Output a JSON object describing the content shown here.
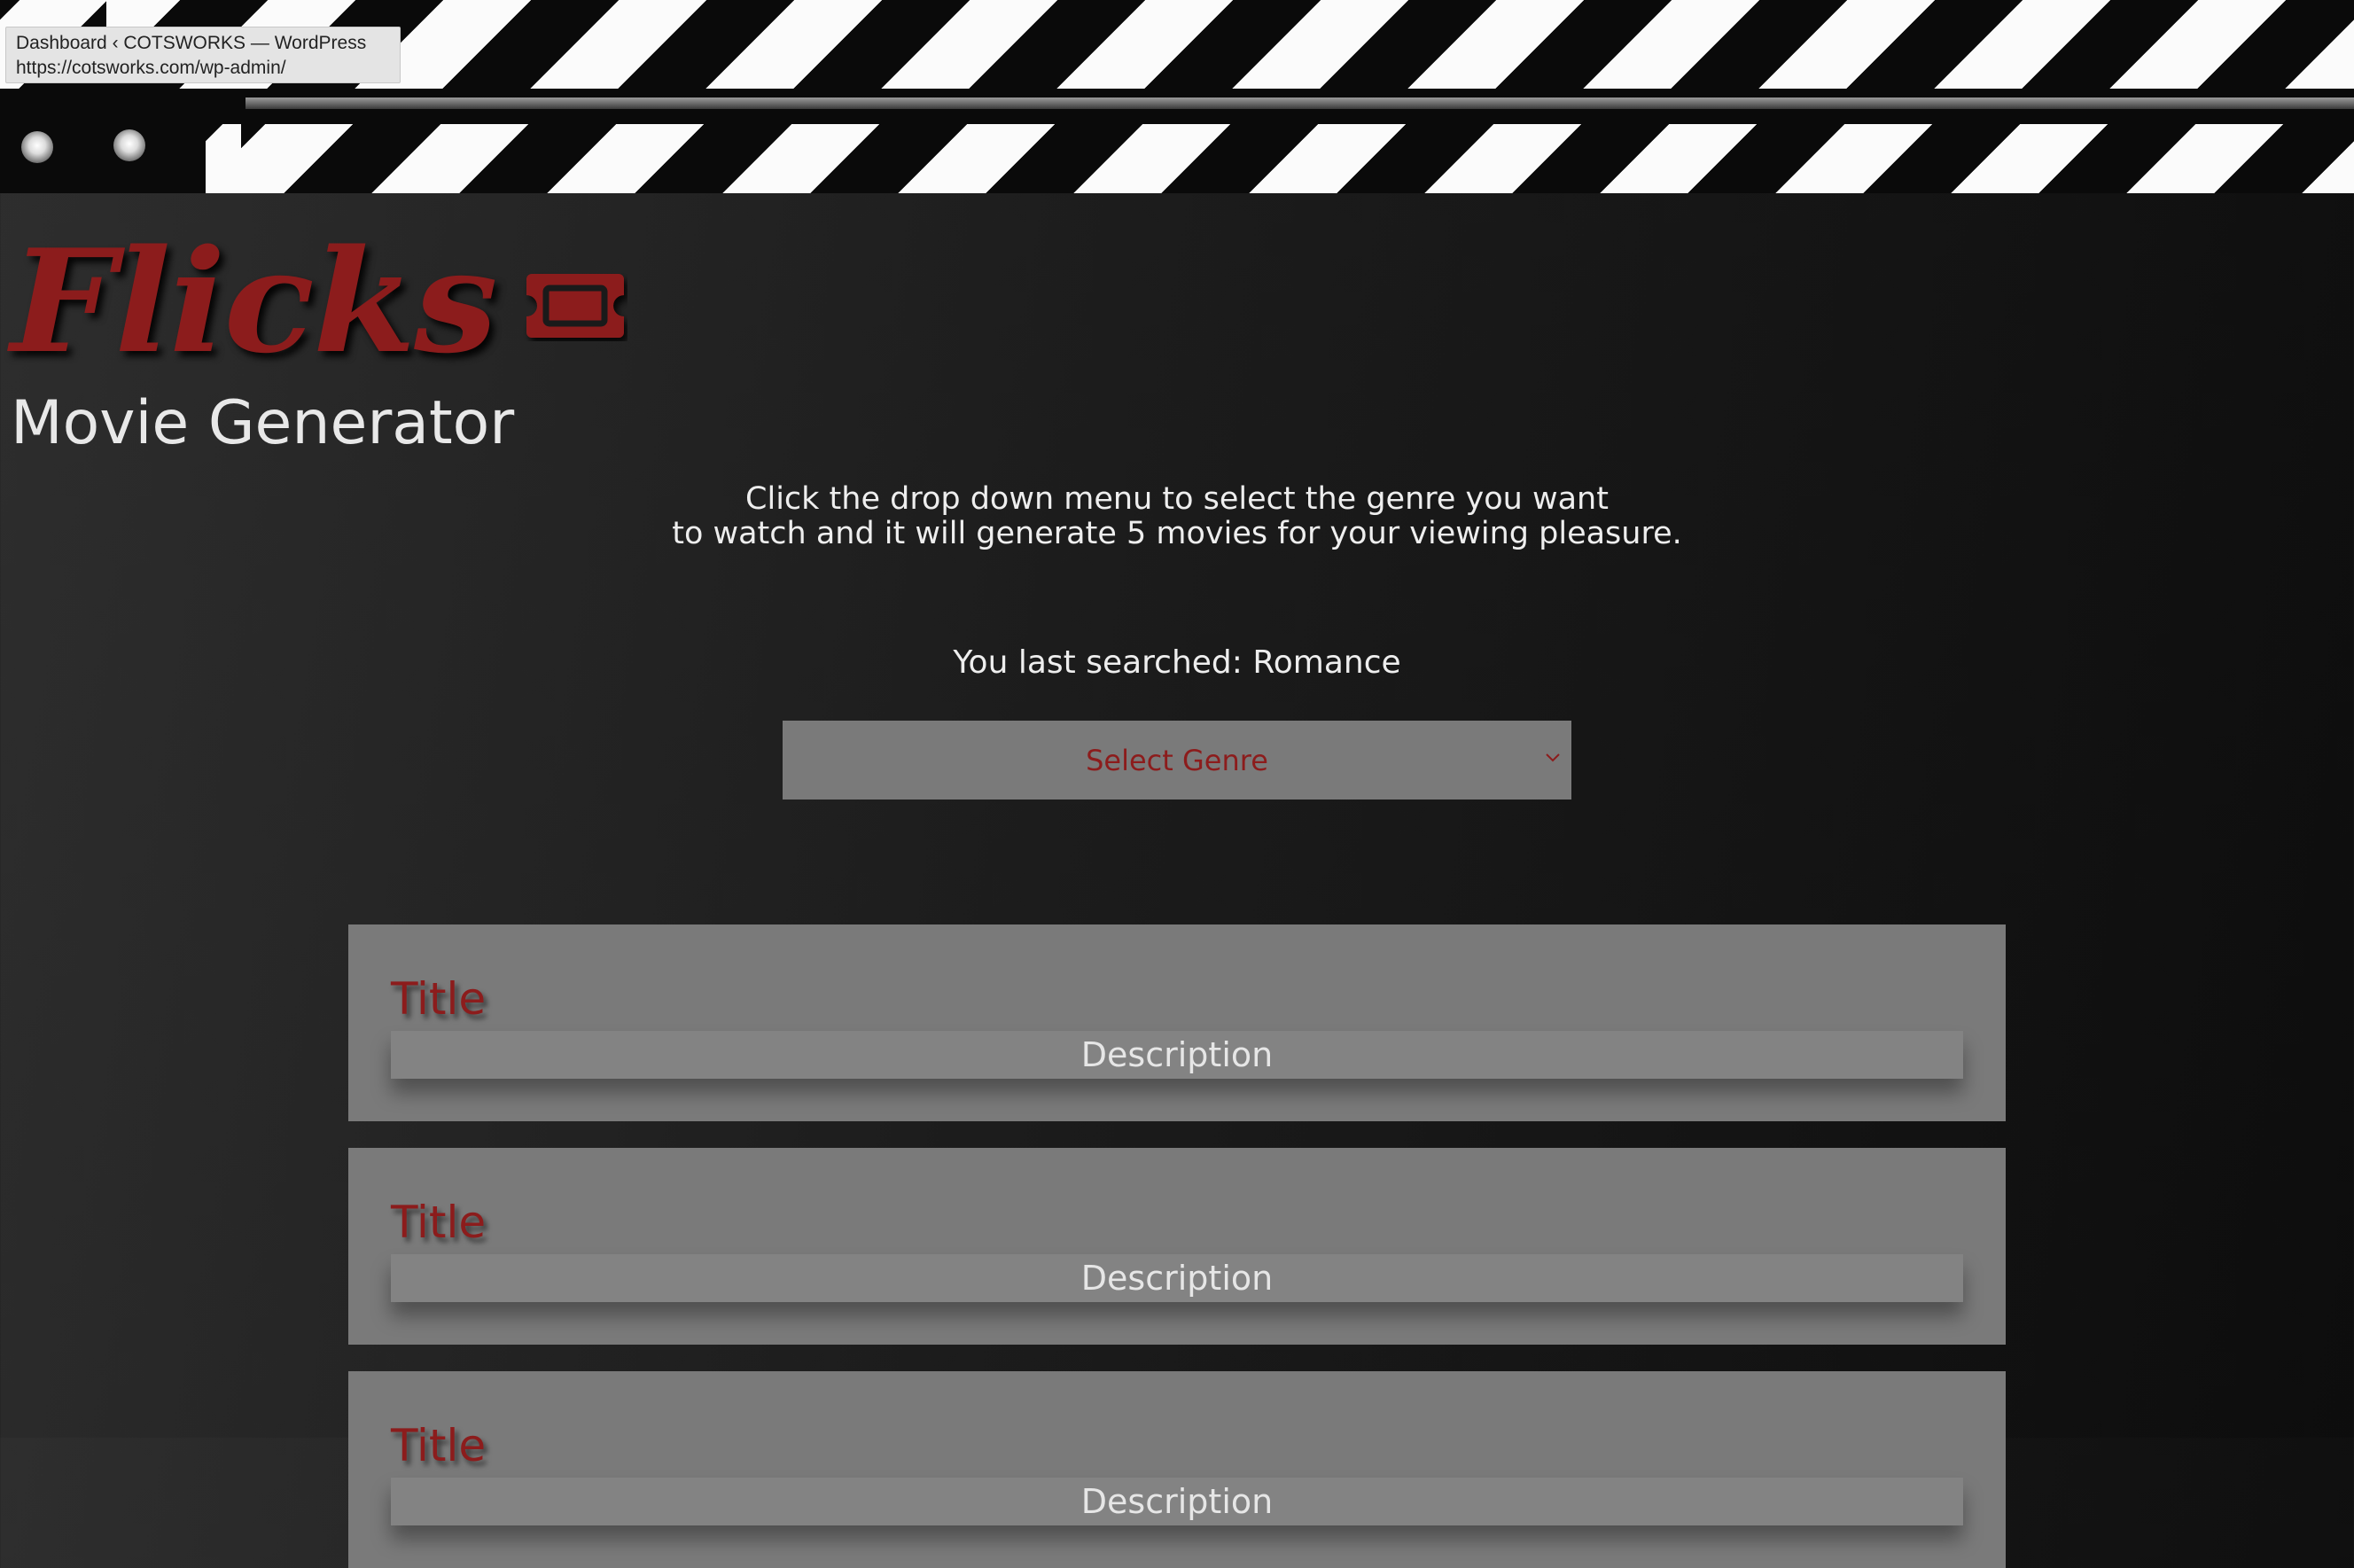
{
  "tooltip": {
    "title": "Dashboard ‹ COTSWORKS — WordPress",
    "url": "https://cotsworks.com/wp-admin/"
  },
  "header": {
    "logo_text": "Flicks",
    "logo_icon": "ticket-icon",
    "subtitle": "Movie Generator"
  },
  "intro": {
    "line1": "Click the drop down menu to select the genre you want",
    "line2": "to watch and it will generate 5 movies for your viewing pleasure."
  },
  "search": {
    "last_searched": "You last searched: Romance"
  },
  "genre_select": {
    "selected": "Select Genre",
    "icon": "chevron-down-icon"
  },
  "movies": [
    {
      "title": "Title",
      "description": "Description"
    },
    {
      "title": "Title",
      "description": "Description"
    },
    {
      "title": "Title",
      "description": "Description"
    }
  ],
  "colors": {
    "accent": "#8c1c1c",
    "card": "#7a7a7a",
    "background": "#1c1c1c"
  }
}
